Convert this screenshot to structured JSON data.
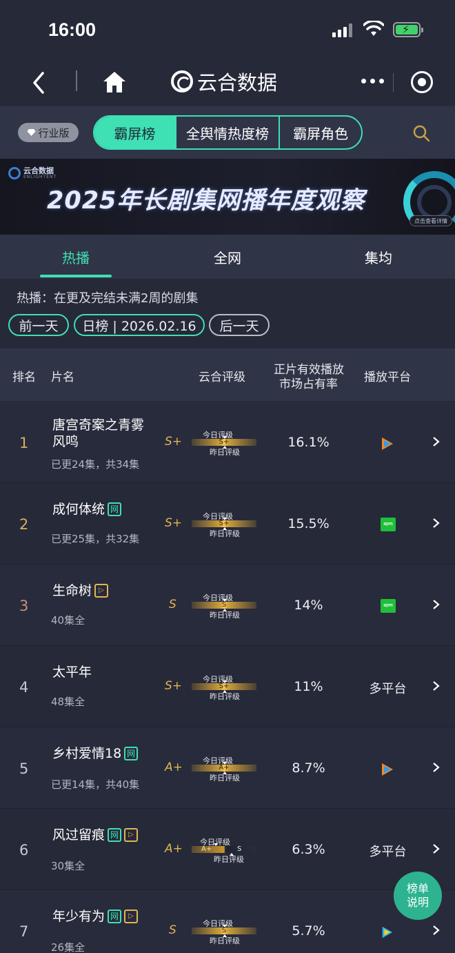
{
  "status_bar": {
    "time": "16:00"
  },
  "nav": {
    "title": "云合数据"
  },
  "filter": {
    "edition": "行业版",
    "segments": [
      "霸屏榜",
      "全舆情热度榜",
      "霸屏角色"
    ]
  },
  "banner": {
    "brand": "云合数据",
    "brand_sub": "ENLIGHTENT",
    "headline": "2025年长剧集网播年度观察",
    "detail_button": "点击查看详情"
  },
  "tabs": [
    "热播",
    "全网",
    "集均"
  ],
  "description": "热播：在更及完结未满2周的剧集",
  "date_nav": {
    "prev": "前一天",
    "current": "日榜 | 2026.02.16",
    "next": "后一天"
  },
  "table": {
    "headers": {
      "rank": "排名",
      "name": "片名",
      "rating": "云合评级",
      "share_line1": "正片有效播放",
      "share_line2": "市场占有率",
      "platform": "播放平台"
    },
    "grade_labels": {
      "today": "今日评级",
      "yesterday": "昨日评级"
    },
    "rows": [
      {
        "rank": "1",
        "name_line1": "唐宫奇案之青雾",
        "name_line2": "风鸣",
        "sub": "已更24集，共34集",
        "grade": "S+",
        "bar_text": "S+",
        "share": "16.1%",
        "platform": "tencent-video-icon"
      },
      {
        "rank": "2",
        "name": "成何体统",
        "tags": [
          "网"
        ],
        "sub": "已更25集，共32集",
        "grade": "S+",
        "bar_text": "S+",
        "share": "15.5%",
        "platform": "iqiyi-icon"
      },
      {
        "rank": "3",
        "name": "生命树",
        "tags": [
          "play"
        ],
        "sub": "40集全",
        "grade": "S",
        "bar_text": "S",
        "share": "14%",
        "platform": "iqiyi-icon"
      },
      {
        "rank": "4",
        "name": "太平年",
        "sub": "48集全",
        "grade": "S+",
        "bar_text": "S+",
        "share": "11%",
        "platform_text": "多平台"
      },
      {
        "rank": "5",
        "name": "乡村爱情18",
        "tags": [
          "网"
        ],
        "sub": "已更14集，共40集",
        "grade": "A+",
        "bar_text": "A+",
        "share": "8.7%",
        "platform": "tencent-video-icon"
      },
      {
        "rank": "6",
        "name": "风过留痕",
        "tags": [
          "网",
          "play"
        ],
        "sub": "30集全",
        "grade": "A+",
        "bar_left": "A+",
        "bar_right": "S",
        "share": "6.3%",
        "platform_text": "多平台"
      },
      {
        "rank": "7",
        "name": "年少有为",
        "tags": [
          "网",
          "play"
        ],
        "sub": "26集全",
        "grade": "S",
        "bar_text": "S",
        "share": "5.7%",
        "platform": "youku-icon"
      }
    ]
  },
  "tag_text": {
    "web": "网"
  },
  "iqiyi_text": "iQIYI",
  "fab": {
    "line1": "榜单",
    "line2": "说明"
  },
  "colors": {
    "accent": "#3ee0b4",
    "gold": "#e3b554",
    "bg": "#262938"
  }
}
